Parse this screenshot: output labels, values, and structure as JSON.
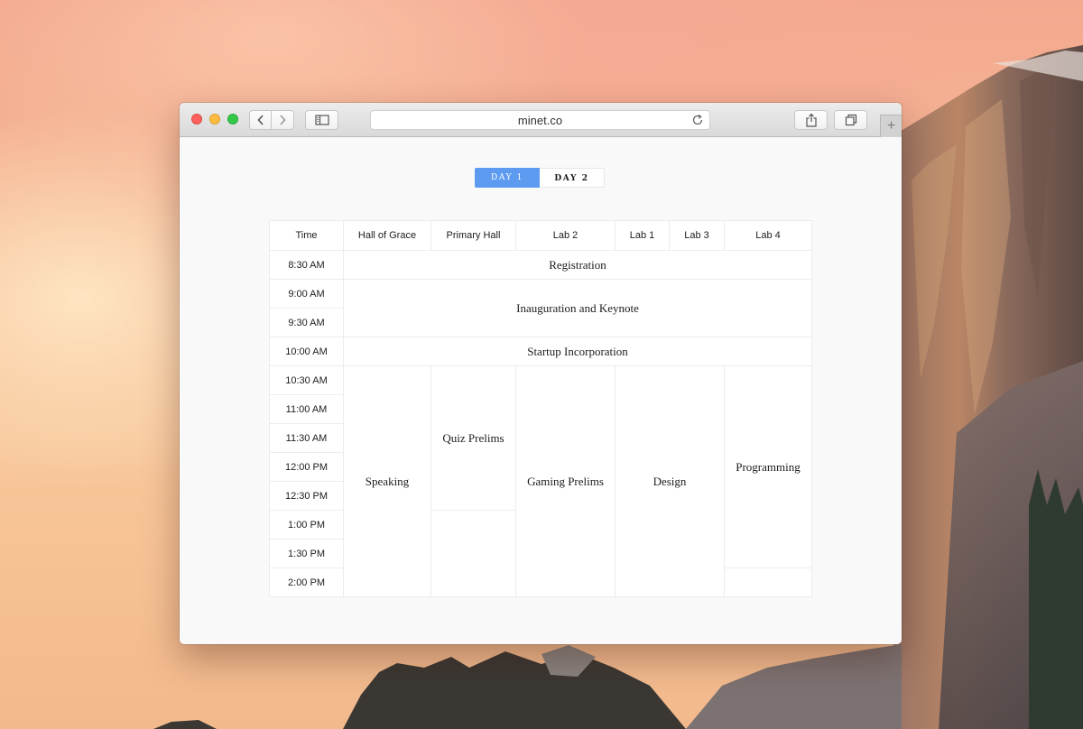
{
  "browser": {
    "url": "minet.co",
    "icons": [
      "back-icon",
      "forward-icon",
      "sidebar-icon",
      "reload-icon",
      "share-icon",
      "tabs-icon",
      "plus-icon"
    ],
    "new_tab_label": "+"
  },
  "day_toggle": {
    "options": [
      "DAY 1",
      "DAY 2"
    ],
    "selected": "DAY 1",
    "active_color": "#5d9bf1"
  },
  "schedule": {
    "columns": [
      "Time",
      "Hall of Grace",
      "Primary Hall",
      "Lab 2",
      "Lab 1",
      "Lab 3",
      "Lab 4"
    ],
    "times": [
      "8:30 AM",
      "9:00 AM",
      "9:30 AM",
      "10:00 AM",
      "10:30 AM",
      "11:00 AM",
      "11:30 AM",
      "12:00 PM",
      "12:30 PM",
      "1:00 PM",
      "1:30 PM",
      "2:00 PM"
    ],
    "plenary": {
      "registration": "Registration",
      "inauguration": "Inauguration and Keynote",
      "startup": "Startup Incorporation"
    },
    "sessions": {
      "speaking": "Speaking",
      "quiz_prelims": "Quiz Prelims",
      "gaming_prelims": "Gaming Prelims",
      "design": "Design",
      "programming": "Programming"
    }
  }
}
